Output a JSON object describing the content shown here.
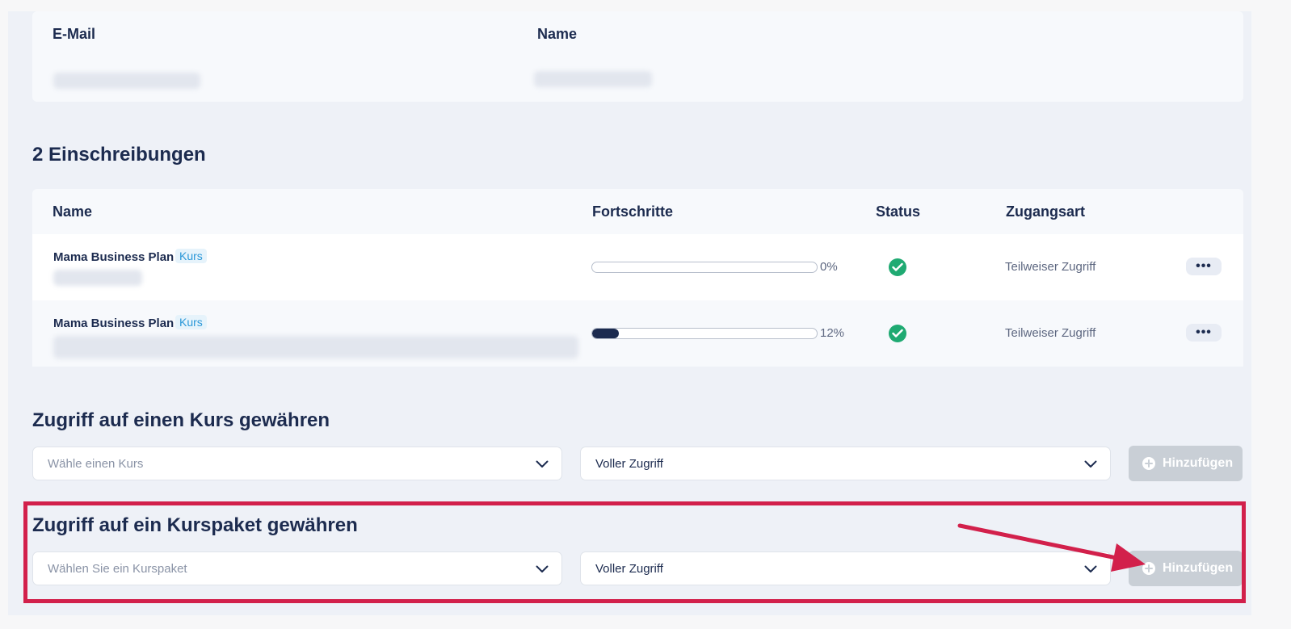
{
  "user_card": {
    "email_header": "E-Mail",
    "name_header": "Name"
  },
  "enrollments": {
    "title": "2 Einschreibungen",
    "columns": {
      "name": "Name",
      "progress": "Fortschritte",
      "status": "Status",
      "access": "Zugangsart"
    },
    "rows": [
      {
        "course": "Mama Business Plan",
        "tag": "Kurs",
        "progress_percent": 0,
        "progress_label": "0%",
        "status": "check-circle-icon",
        "access": "Teilweiser Zugriff",
        "more": "•••"
      },
      {
        "course": "Mama Business Plan",
        "tag": "Kurs",
        "progress_percent": 12,
        "progress_label": "12%",
        "status": "check-circle-icon",
        "access": "Teilweiser Zugriff",
        "more": "•••"
      }
    ]
  },
  "grant_course": {
    "title": "Zugriff auf einen Kurs gewähren",
    "select_placeholder": "Wähle einen Kurs",
    "access_value": "Voller Zugriff",
    "add_label": "Hinzufügen"
  },
  "grant_bundle": {
    "title": "Zugriff auf ein Kurspaket gewähren",
    "select_placeholder": "Wählen Sie ein Kurspaket",
    "access_value": "Voller Zugriff",
    "add_label": "Hinzufügen"
  },
  "colors": {
    "primary": "#1c2b4f",
    "success": "#1faa72",
    "tag_blue": "#2a97d8",
    "disabled_button": "#c9cfd6",
    "annotation_red": "#d2204b"
  }
}
